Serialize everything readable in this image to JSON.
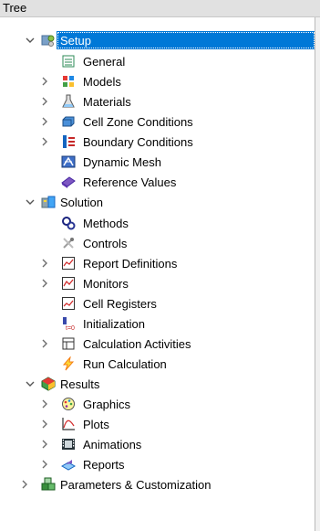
{
  "header": {
    "title": "Tree"
  },
  "tree": {
    "setup": {
      "label": "Setup",
      "children": [
        {
          "label": "General"
        },
        {
          "label": "Models"
        },
        {
          "label": "Materials"
        },
        {
          "label": "Cell Zone Conditions"
        },
        {
          "label": "Boundary Conditions"
        },
        {
          "label": "Dynamic Mesh"
        },
        {
          "label": "Reference Values"
        }
      ]
    },
    "solution": {
      "label": "Solution",
      "children": [
        {
          "label": "Methods"
        },
        {
          "label": "Controls"
        },
        {
          "label": "Report Definitions"
        },
        {
          "label": "Monitors"
        },
        {
          "label": "Cell Registers"
        },
        {
          "label": "Initialization"
        },
        {
          "label": "Calculation Activities"
        },
        {
          "label": "Run Calculation"
        }
      ]
    },
    "results": {
      "label": "Results",
      "children": [
        {
          "label": "Graphics"
        },
        {
          "label": "Plots"
        },
        {
          "label": "Animations"
        },
        {
          "label": "Reports"
        }
      ]
    },
    "parameters": {
      "label": "Parameters & Customization"
    }
  },
  "colors": {
    "selection": "#0078d7",
    "toggle": "#6d6d6d"
  },
  "icons": {
    "general": "list-icon",
    "models": "models-icon",
    "materials": "flask-icon",
    "cell_zone_conditions": "cell-zone-icon",
    "boundary_conditions": "boundary-icon",
    "dynamic_mesh": "dynamic-mesh-icon",
    "reference_values": "reference-values-icon"
  }
}
